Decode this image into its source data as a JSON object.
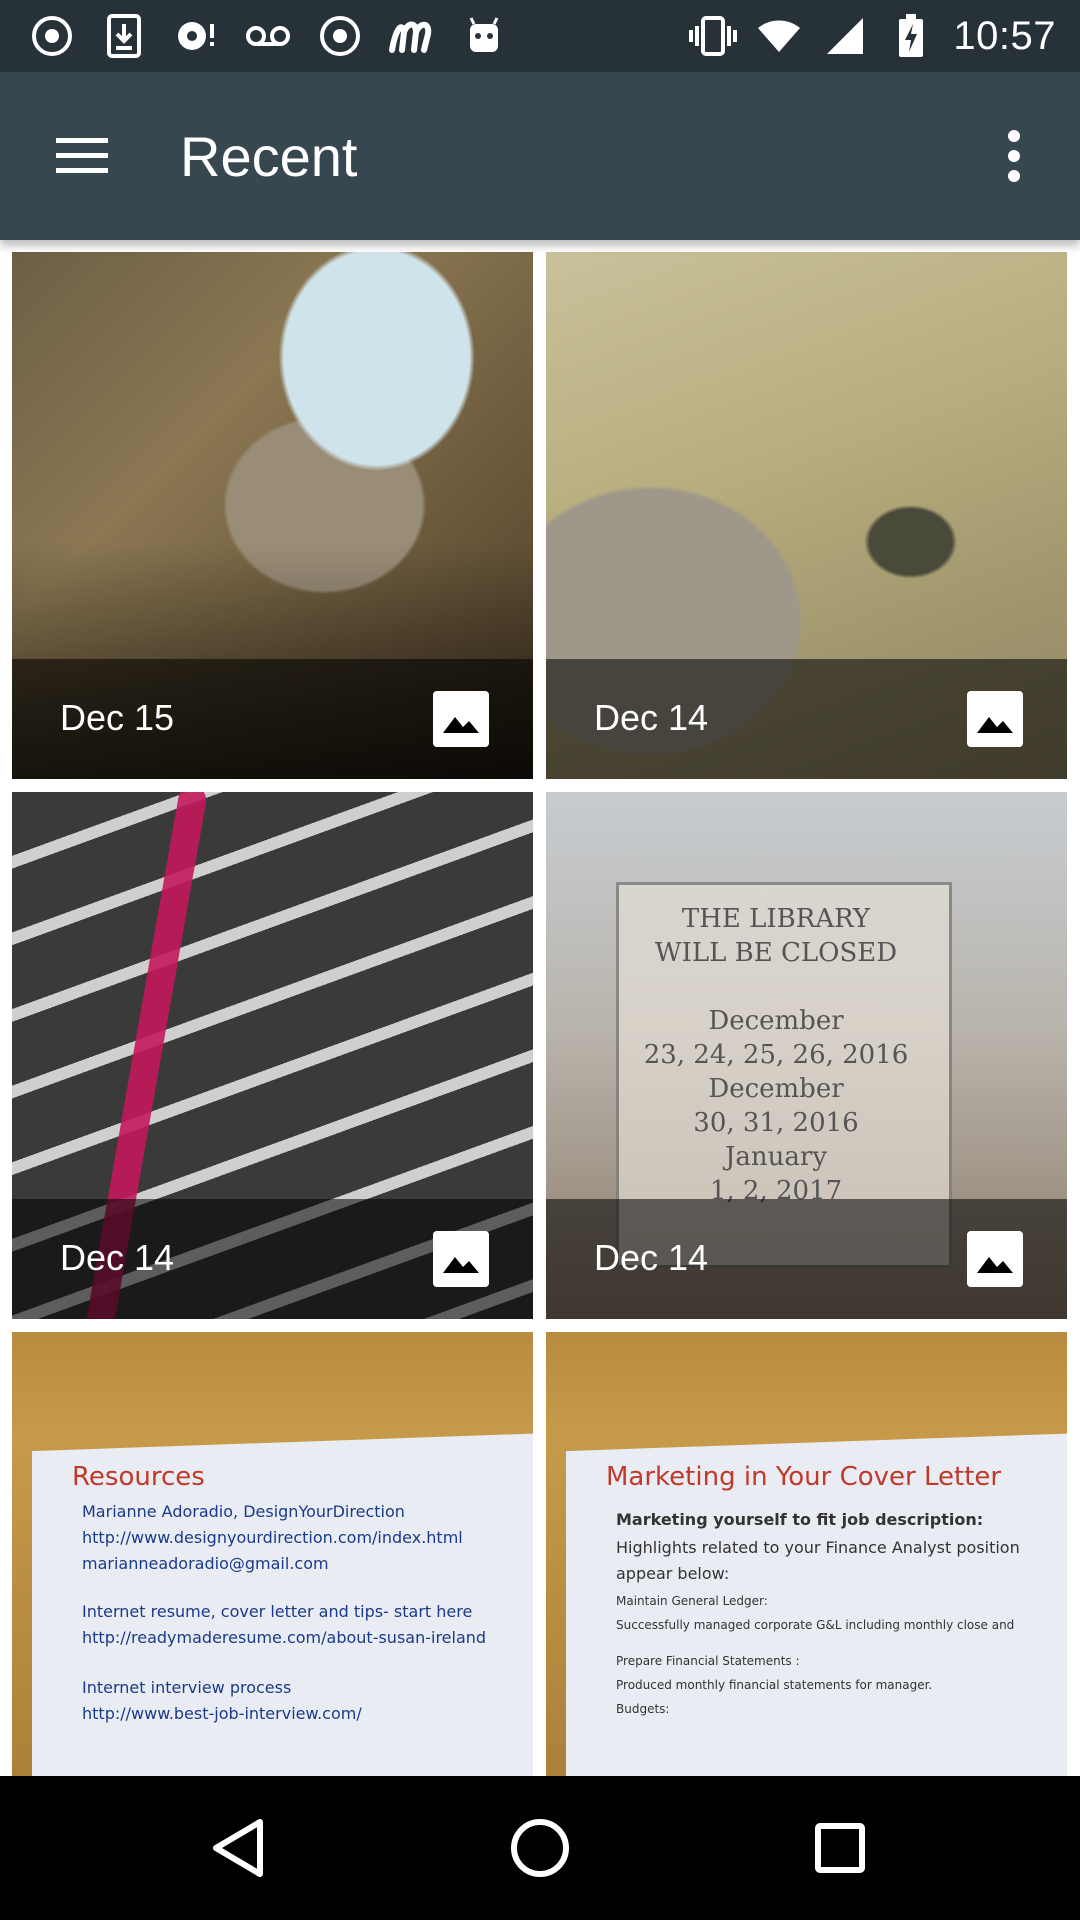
{
  "status_bar": {
    "time": "10:57",
    "left_icons": [
      "chrome-icon",
      "download-icon",
      "sync-icon",
      "voicemail-icon",
      "chrome-icon",
      "m-app-icon",
      "android-icon"
    ],
    "right_icons": [
      "vibrate-icon",
      "wifi-icon",
      "signal-icon",
      "battery-charging-icon"
    ]
  },
  "app_bar": {
    "title": "Recent",
    "menu_icon": "hamburger-menu-icon",
    "overflow_icon": "more-vert-icon"
  },
  "grid": {
    "items": [
      {
        "date": "Dec 15",
        "type_icon": "image-icon"
      },
      {
        "date": "Dec 14",
        "type_icon": "image-icon"
      },
      {
        "date": "Dec 14",
        "type_icon": "image-icon"
      },
      {
        "date": "Dec 14",
        "type_icon": "image-icon"
      },
      {
        "date": "",
        "type_icon": "image-icon"
      },
      {
        "date": "",
        "type_icon": "image-icon"
      }
    ]
  },
  "nav_bar": {
    "icons": [
      "back-icon",
      "home-icon",
      "recents-icon"
    ]
  },
  "colors": {
    "status_bar": "#263238",
    "app_bar": "#37474F",
    "nav_bar": "#000000"
  }
}
